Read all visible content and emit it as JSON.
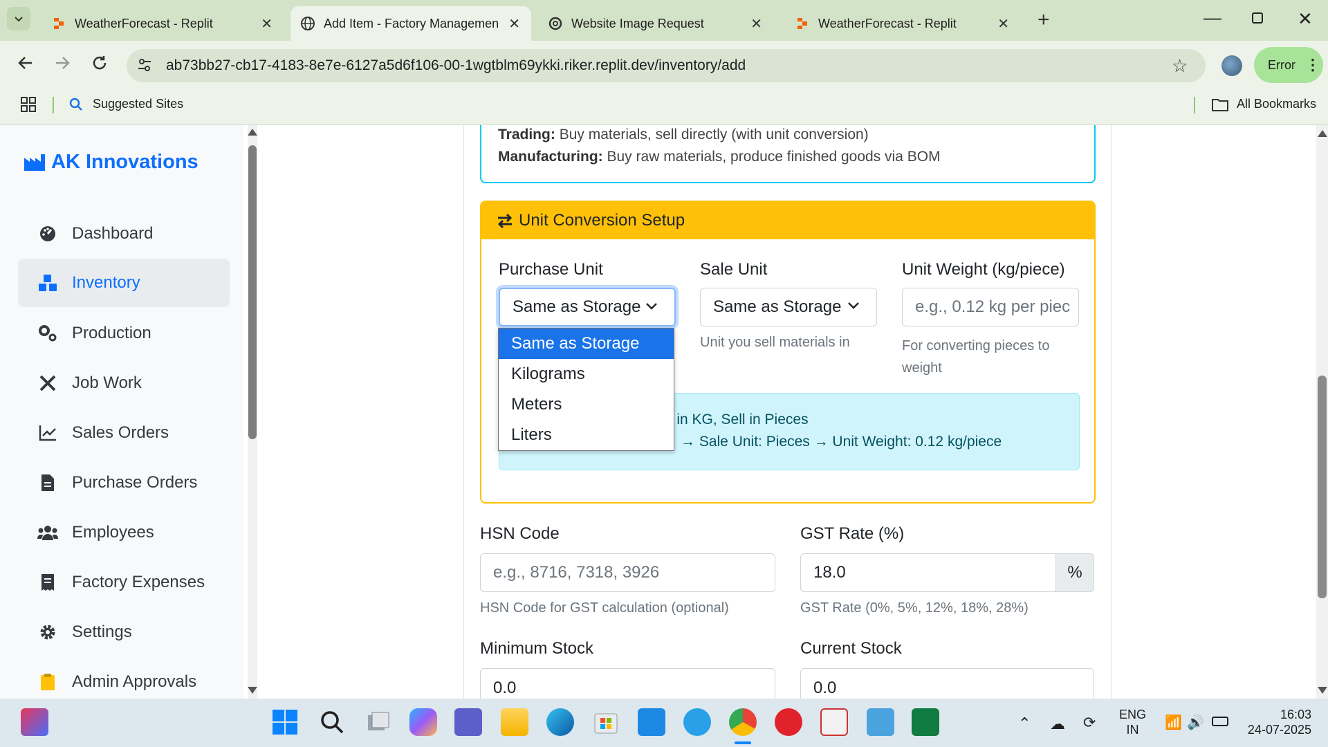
{
  "browser": {
    "tabs": [
      {
        "title": "WeatherForecast - Replit"
      },
      {
        "title": "Add Item - Factory Managemen"
      },
      {
        "title": "Website Image Request"
      },
      {
        "title": "WeatherForecast - Replit"
      }
    ],
    "url": "ab73bb27-cb17-4183-8e7e-6127a5d6f106-00-1wgtblm69ykki.riker.replit.dev/inventory/add",
    "error_label": "Error",
    "bookmarks": {
      "suggested": "Suggested Sites",
      "all": "All Bookmarks"
    }
  },
  "sidebar": {
    "brand": "AK Innovations",
    "items": [
      {
        "label": "Dashboard",
        "icon": "tachometer-icon"
      },
      {
        "label": "Inventory",
        "icon": "boxes-icon"
      },
      {
        "label": "Production",
        "icon": "cogs-icon"
      },
      {
        "label": "Job Work",
        "icon": "tools-icon"
      },
      {
        "label": "Sales Orders",
        "icon": "chart-line-icon"
      },
      {
        "label": "Purchase Orders",
        "icon": "file-invoice-icon"
      },
      {
        "label": "Employees",
        "icon": "users-icon"
      },
      {
        "label": "Factory Expenses",
        "icon": "receipt-icon"
      },
      {
        "label": "Settings",
        "icon": "gear-icon"
      },
      {
        "label": "Admin Approvals",
        "icon": "clipboard-check-icon"
      }
    ]
  },
  "info": {
    "trading_label": "Trading:",
    "trading_text": "Buy materials, sell directly (with unit conversion)",
    "manufacturing_label": "Manufacturing:",
    "manufacturing_text": "Buy raw materials, produce finished goods via BOM"
  },
  "unit_conversion": {
    "title": "Unit Conversion Setup",
    "purchase_unit_label": "Purchase Unit",
    "purchase_unit_value": "Same as Storage",
    "sale_unit_label": "Sale Unit",
    "sale_unit_value": "Same as Storage",
    "sale_unit_help": "Unit you sell materials in",
    "unit_weight_label": "Unit Weight (kg/piece)",
    "unit_weight_placeholder": "e.g., 0.12 kg per piec",
    "unit_weight_help": "For converting pieces to weight",
    "alert_line1": "s in KG, Sell in Pieces",
    "alert_line2": "→ Sale Unit: Pieces → Unit Weight: 0.12 kg/piece",
    "dropdown_options": [
      "Same as Storage",
      "Kilograms",
      "Meters",
      "Liters"
    ]
  },
  "form": {
    "hsn_label": "HSN Code",
    "hsn_placeholder": "e.g., 8716, 7318, 3926",
    "hsn_help": "HSN Code for GST calculation (optional)",
    "gst_label": "GST Rate (%)",
    "gst_value": "18.0",
    "gst_suffix": "%",
    "gst_help": "GST Rate (0%, 5%, 12%, 18%, 28%)",
    "min_stock_label": "Minimum Stock",
    "min_stock_value": "0.0",
    "current_stock_label": "Current Stock",
    "current_stock_value": "0.0"
  },
  "taskbar": {
    "lang_top": "ENG",
    "lang_bottom": "IN",
    "time": "16:03",
    "date": "24-07-2025"
  },
  "colors": {
    "brand": "#0d6efd",
    "warning": "#ffc107",
    "info_border": "#0dcaf0",
    "info_bg": "#cff4fc"
  }
}
